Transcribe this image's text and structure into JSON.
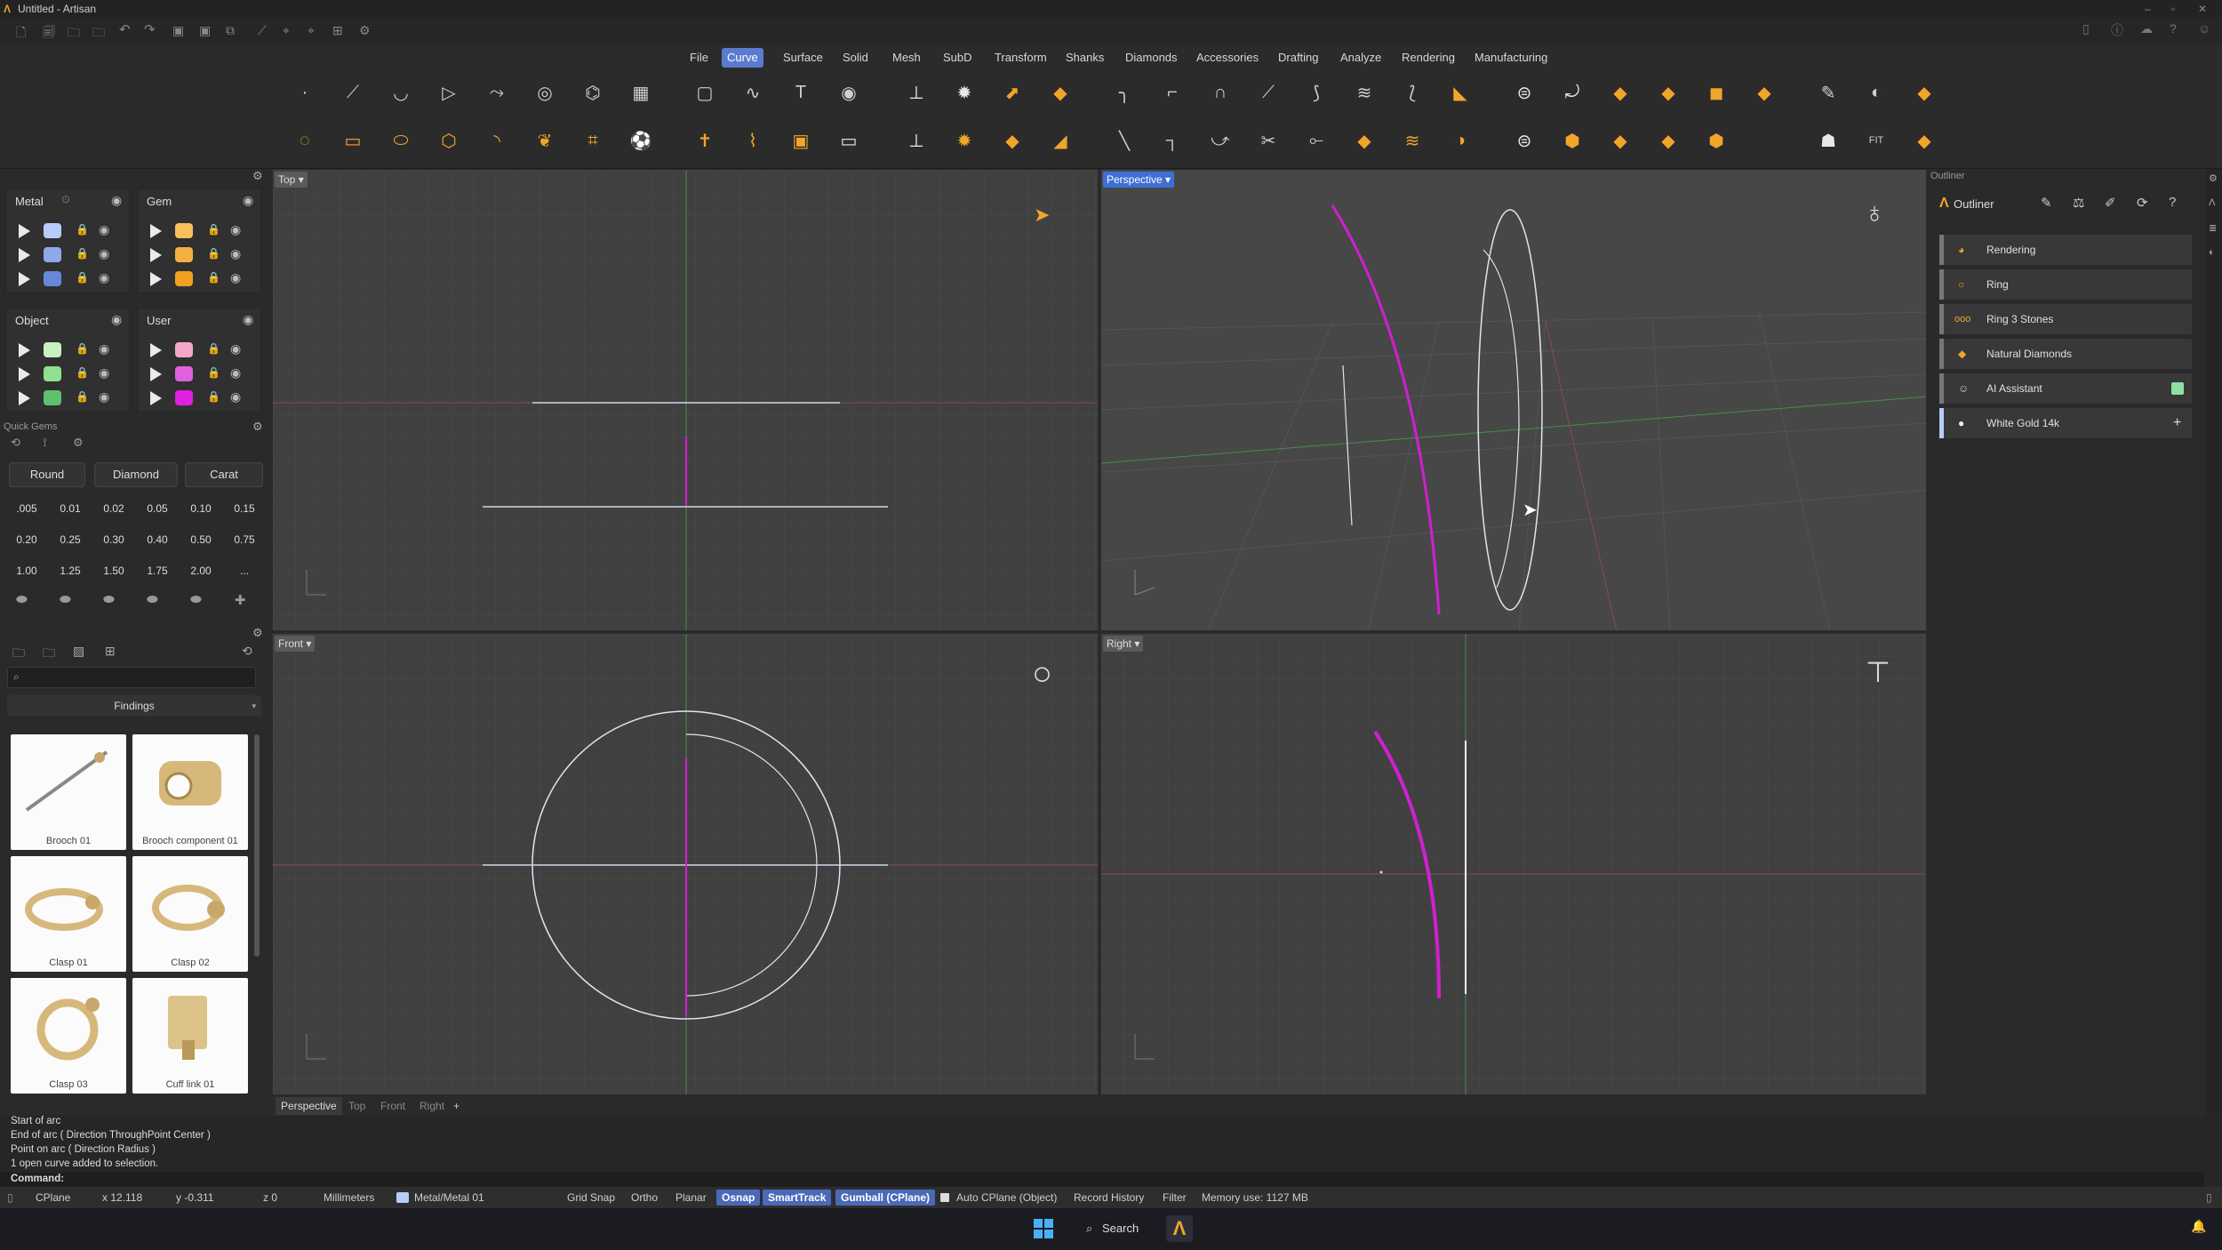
{
  "window": {
    "title": "Untitled - Artisan"
  },
  "menu": [
    {
      "label": "File"
    },
    {
      "label": "Curve"
    },
    {
      "label": "Surface"
    },
    {
      "label": "Solid"
    },
    {
      "label": "Mesh"
    },
    {
      "label": "SubD"
    },
    {
      "label": "Transform"
    },
    {
      "label": "Shanks"
    },
    {
      "label": "Diamonds"
    },
    {
      "label": "Accessories"
    },
    {
      "label": "Drafting"
    },
    {
      "label": "Analyze"
    },
    {
      "label": "Rendering"
    },
    {
      "label": "Manufacturing"
    }
  ],
  "active_menu": "Curve",
  "toolbar": {
    "fit_label": "FIT"
  },
  "layers": {
    "metal": {
      "title": "Metal",
      "colors": [
        "#b8ccfa",
        "#8fa8e8",
        "#6688d8"
      ]
    },
    "gem": {
      "title": "Gem",
      "colors": [
        "#f7c05a",
        "#f4b040",
        "#f0a020"
      ]
    },
    "object": {
      "title": "Object",
      "colors": [
        "#c8f0c0",
        "#90e090",
        "#60c070"
      ]
    },
    "user": {
      "title": "User",
      "colors": [
        "#f4a8c8",
        "#e060e0",
        "#e020e0"
      ]
    }
  },
  "quick_gems": {
    "title": "Quick Gems",
    "shape_buttons": [
      "Round",
      "Diamond",
      "Carat"
    ],
    "carats": [
      ".005",
      "0.01",
      "0.02",
      "0.05",
      "0.10",
      "0.15",
      "0.20",
      "0.25",
      "0.30",
      "0.40",
      "0.50",
      "0.75",
      "1.00",
      "1.25",
      "1.50",
      "1.75",
      "2.00",
      "..."
    ]
  },
  "library": {
    "category": "Findings",
    "items": [
      {
        "label": "Brooch 01"
      },
      {
        "label": "Brooch component 01"
      },
      {
        "label": "Clasp 01"
      },
      {
        "label": "Clasp 02"
      },
      {
        "label": "Clasp 03"
      },
      {
        "label": "Cuff link 01"
      }
    ]
  },
  "viewports": {
    "top": "Top",
    "perspective": "Perspective",
    "front": "Front",
    "right": "Right"
  },
  "viewport_tabs": [
    "Perspective",
    "Top",
    "Front",
    "Right"
  ],
  "outliner": {
    "panel_title": "Outliner",
    "tab_label": "Outliner",
    "items": [
      {
        "label": "Rendering"
      },
      {
        "label": "Ring"
      },
      {
        "label": "Ring 3 Stones"
      },
      {
        "label": "Natural Diamonds"
      },
      {
        "label": "AI Assistant"
      },
      {
        "label": "White Gold 14k"
      }
    ]
  },
  "command_history": [
    "Start of arc",
    "End of arc ( Direction  ThroughPoint  Center )",
    "Point on arc ( Direction  Radius )",
    "1 open curve added to selection."
  ],
  "command_prompt": "Command:",
  "status": {
    "cplane": "CPlane",
    "x": "x 12.118",
    "y": "y -0.311",
    "z": "z 0",
    "units": "Millimeters",
    "layer": "Metal/Metal 01",
    "grid_snap": "Grid Snap",
    "ortho": "Ortho",
    "planar": "Planar",
    "osnap": "Osnap",
    "smarttrack": "SmartTrack",
    "gumball": "Gumball (CPlane)",
    "auto_cplane": "Auto CPlane (Object)",
    "record_history": "Record History",
    "filter": "Filter",
    "memory": "Memory use: 1127 MB"
  },
  "taskbar": {
    "search": "Search"
  }
}
